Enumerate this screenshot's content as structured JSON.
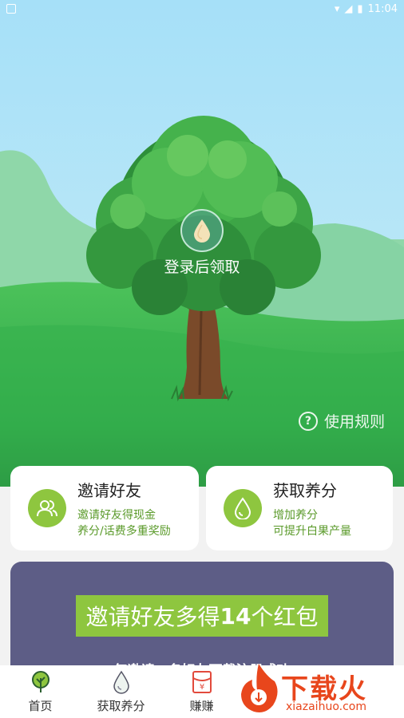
{
  "statusbar": {
    "time": "11:04"
  },
  "hero": {
    "login_text": "登录后领取",
    "rules_label": "使用规则",
    "rules_icon": "question-circle-icon"
  },
  "cards": [
    {
      "title": "邀请好友",
      "line1": "邀请好友得现金",
      "line2": "养分/话费多重奖励",
      "icon": "friends-icon"
    },
    {
      "title": "获取养分",
      "line1": "增加养分",
      "line2": "可提升白果产量",
      "icon": "water-drop-icon"
    }
  ],
  "promo": {
    "banner_pre": "邀请好友多得",
    "banner_num": "14",
    "banner_post": "个红包",
    "subtitle": "每邀请一名好友下载注册成功"
  },
  "nav": [
    {
      "label": "首页",
      "icon": "tree-icon"
    },
    {
      "label": "获取养分",
      "icon": "drop-outline-icon"
    },
    {
      "label": "赚赚",
      "icon": "red-envelope-icon"
    },
    {
      "label": "",
      "icon": "hidden"
    },
    {
      "label": "",
      "icon": "hidden"
    }
  ],
  "watermark": {
    "title": "下载火",
    "url": "xiazaihuo.com"
  },
  "colors": {
    "accent_green": "#8ec63f",
    "promo_purple": "#5d5d86",
    "sky": "#a9e1f6"
  }
}
